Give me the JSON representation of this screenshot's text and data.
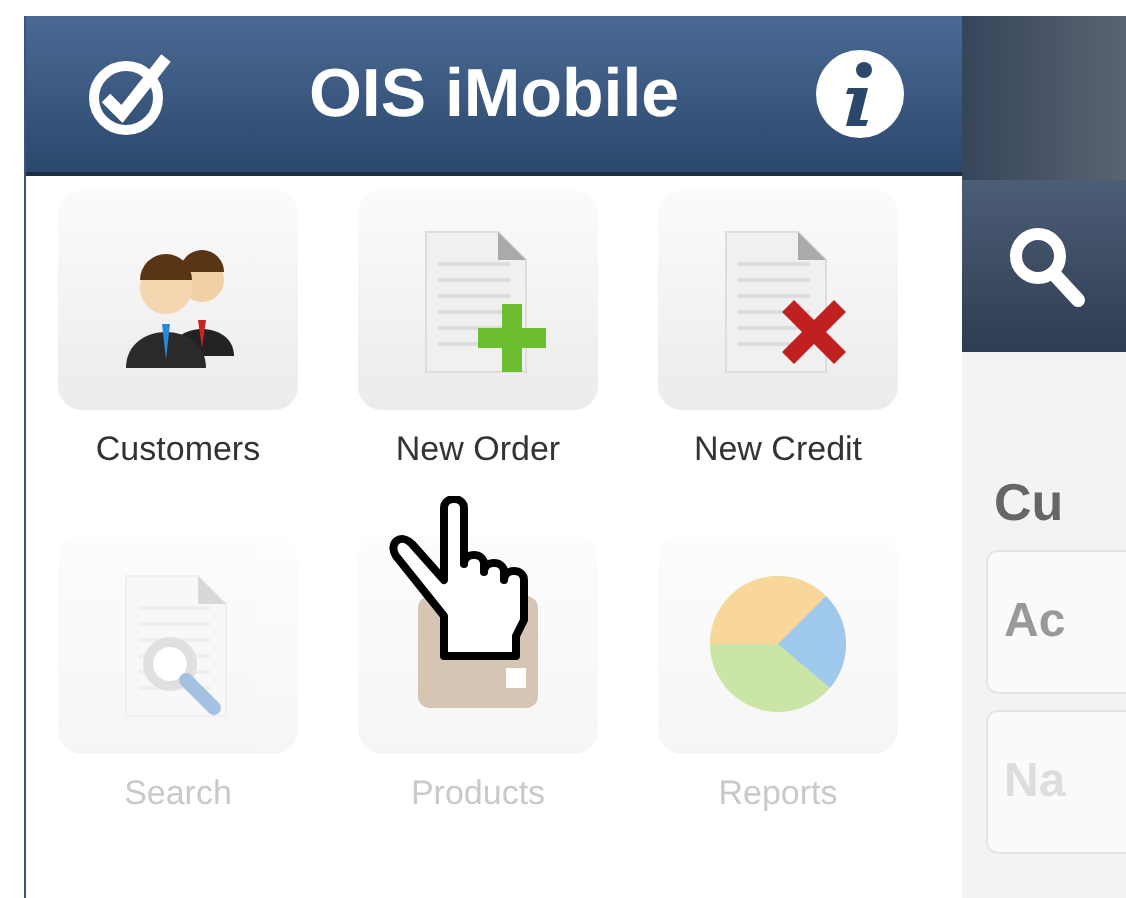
{
  "app": {
    "title": "OIS iMobile"
  },
  "tiles": [
    {
      "kind": "customers",
      "label": "Customers",
      "disabled": false
    },
    {
      "kind": "new-order",
      "label": "New Order",
      "disabled": false
    },
    {
      "kind": "new-credit",
      "label": "New Credit",
      "disabled": false
    },
    {
      "kind": "search",
      "label": "Search",
      "disabled": true
    },
    {
      "kind": "products",
      "label": "Products",
      "disabled": true
    },
    {
      "kind": "reports",
      "label": "Reports",
      "disabled": true
    }
  ],
  "side_pane": {
    "heading": "Cu",
    "rows": [
      "Ac",
      "Na"
    ]
  }
}
